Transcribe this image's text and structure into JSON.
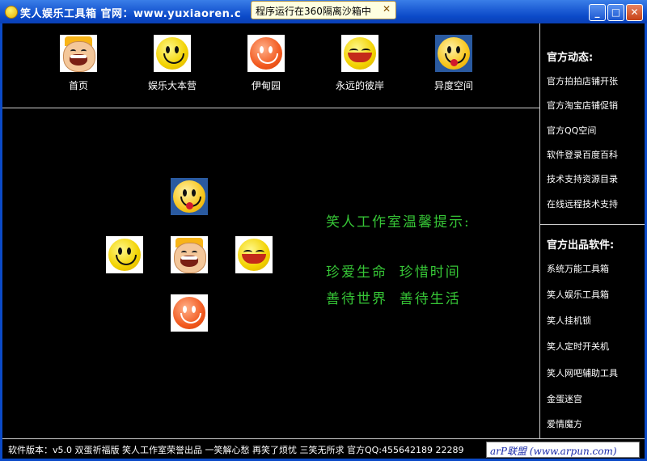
{
  "window": {
    "title": "笑人娱乐工具箱    官网：www.yuxiaoren.c",
    "sandbox_notice": "程序运行在360隔离沙箱中",
    "sandbox_close": "✕",
    "minimize": "_",
    "maximize": "□",
    "close": "✕"
  },
  "topnav": {
    "items": [
      {
        "label": "首页",
        "icon": "laughing-kid-icon"
      },
      {
        "label": "娱乐大本营",
        "icon": "smiley-icon"
      },
      {
        "label": "伊甸园",
        "icon": "red-smiley-icon"
      },
      {
        "label": "永远的彼岸",
        "icon": "tongue-smiley-icon"
      },
      {
        "label": "异度空间",
        "icon": "tongue-out-smiley-icon"
      }
    ]
  },
  "main": {
    "greeting_title": "笑人工作室温馨提示:",
    "greeting_line1": "珍爱生命  珍惜时间",
    "greeting_line2": "善待世界  善待生活"
  },
  "sidebar": {
    "news_title": "官方动态:",
    "news_links": [
      "官方拍拍店铺开张",
      "官方淘宝店铺促销",
      "官方QQ空间",
      "软件登录百度百科",
      "技术支持资源目录",
      "在线远程技术支持"
    ],
    "products_title": "官方出品软件:",
    "product_links": [
      "系统万能工具箱",
      "笑人娱乐工具箱",
      "笑人挂机锁",
      "笑人定时开关机",
      "笑人网吧辅助工具",
      "金蛋迷宫",
      "爱情魔方"
    ]
  },
  "statusbar": {
    "text": "软件版本：v5.0 双蛋祈福版  笑人工作室荣誉出品  一笑解心愁 再笑了烦忧 三笑无所求  官方QQ:455642189 22289"
  },
  "watermark": {
    "text": "arP联盟 (www.arpun.com)"
  },
  "colors": {
    "titlebar": "#0b4ac8",
    "background": "#000000",
    "greeting": "#36c536",
    "divider": "#cfcfcf"
  }
}
